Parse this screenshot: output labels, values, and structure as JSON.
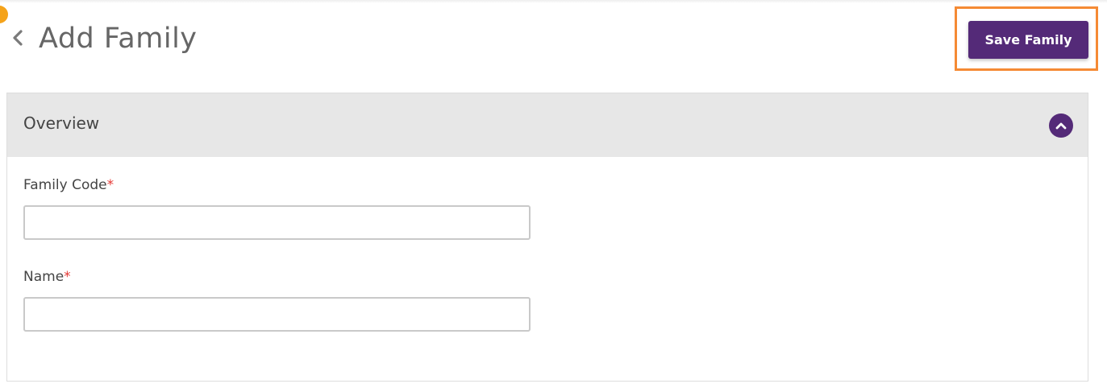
{
  "header": {
    "title": "Add Family",
    "save_label": "Save Family",
    "back_icon": "chevron-left-icon"
  },
  "overview": {
    "title": "Overview",
    "toggle_icon": "chevron-up-icon",
    "fields": [
      {
        "label": "Family Code",
        "required_mark": "*",
        "value": "",
        "placeholder": ""
      },
      {
        "label": "Name",
        "required_mark": "*",
        "value": "",
        "placeholder": ""
      }
    ]
  },
  "colors": {
    "accent": "#542a78",
    "highlight": "#f58a34",
    "required": "#e53935",
    "indicator": "#f5a31a"
  }
}
